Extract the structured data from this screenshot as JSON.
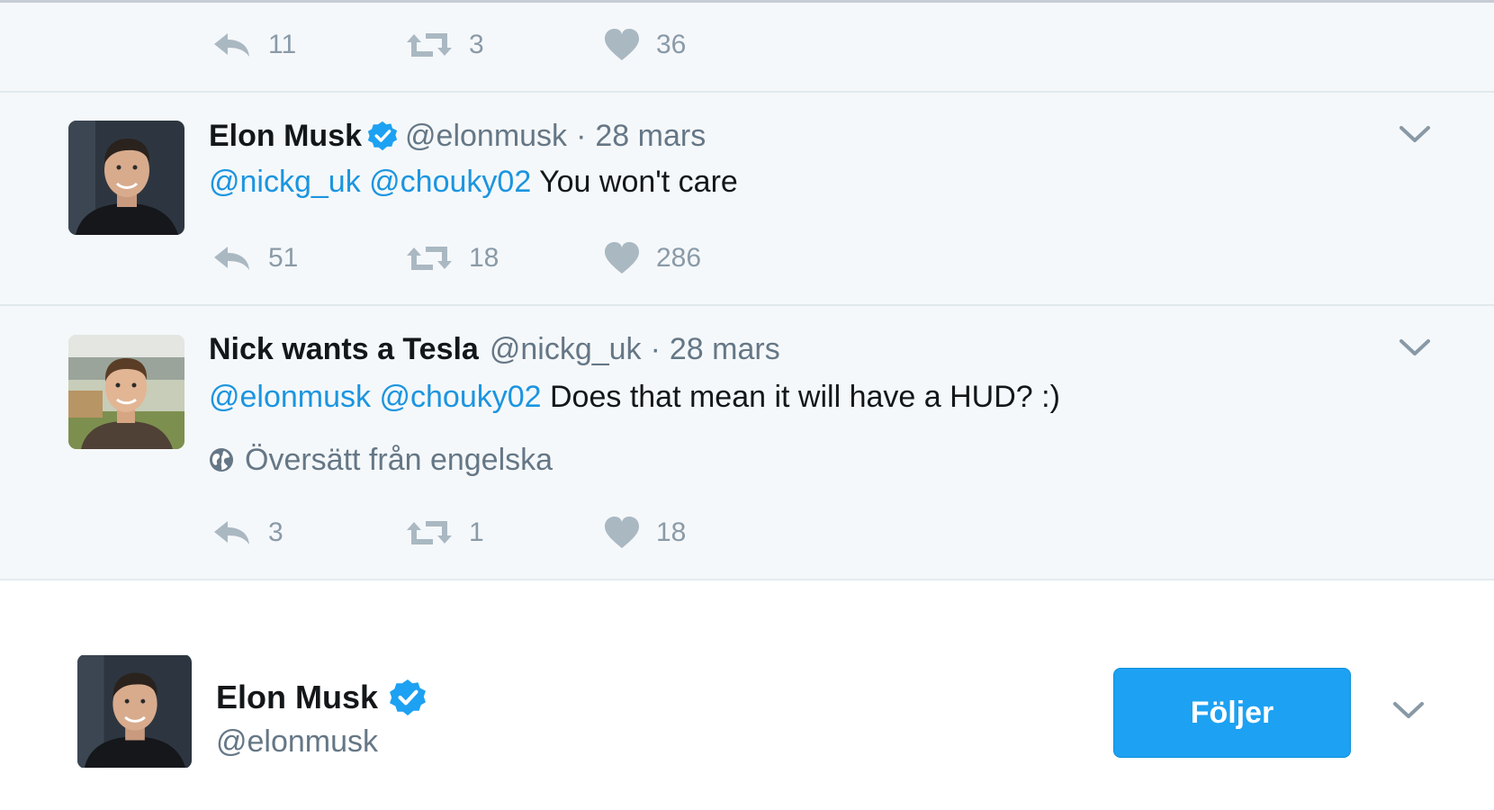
{
  "colors": {
    "thread_background": "#f5f8fa",
    "mention": "#1b95e0",
    "action_icon": "#aab8c2",
    "follow_button": "#1da1f2",
    "verified_badge": "#1da1f2"
  },
  "tweets": [
    {
      "partial": true,
      "actions": {
        "replies": "11",
        "retweets": "3",
        "likes": "36"
      }
    },
    {
      "name": "Elon Musk",
      "verified": true,
      "handle": "@elonmusk",
      "separator": "·",
      "time": "28 mars",
      "mentions": [
        "@nickg_uk",
        "@chouky02"
      ],
      "text": "You won't care",
      "actions": {
        "replies": "51",
        "retweets": "18",
        "likes": "286"
      }
    },
    {
      "name": "Nick wants a Tesla",
      "verified": false,
      "handle": "@nickg_uk",
      "separator": "·",
      "time": "28 mars",
      "mentions": [
        "@elonmusk",
        "@chouky02"
      ],
      "text": "Does that mean it will have a HUD? :)",
      "translate_label": "Översätt från engelska",
      "actions": {
        "replies": "3",
        "retweets": "1",
        "likes": "18"
      }
    }
  ],
  "profile_card": {
    "name": "Elon Musk",
    "verified": true,
    "handle": "@elonmusk",
    "follow_button_label": "Följer"
  }
}
